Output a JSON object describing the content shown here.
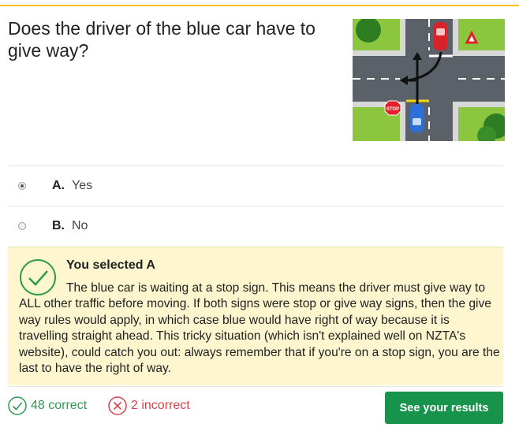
{
  "question": {
    "text": "Does the driver of the blue car have to give way?"
  },
  "diagram": {
    "stop_sign_text": "STOP",
    "give_way_sign_text": "GIVE WAY"
  },
  "options": [
    {
      "letter": "A.",
      "text": "Yes",
      "selected": true
    },
    {
      "letter": "B.",
      "text": "No",
      "selected": false
    }
  ],
  "feedback": {
    "title": "You selected A",
    "body": "The blue car is waiting at a stop sign. This means the driver must give way to ALL other traffic before moving. If both signs were stop or give way signs, then the give way rules would apply, in which case blue would have right of way because it is travelling straight ahead. This tricky situation (which isn't explained well on NZTA's website), could catch you out: always remember that if you're on a stop sign, you are the last to have the right of way."
  },
  "stats": {
    "correct": "48 correct",
    "incorrect": "2 incorrect"
  },
  "results_button": {
    "label": "See your results"
  },
  "colors": {
    "accent": "#f2c500",
    "correct": "#2f9b4f",
    "incorrect": "#d9434a",
    "button": "#17934b",
    "feedback_bg": "#fdf6cf"
  }
}
